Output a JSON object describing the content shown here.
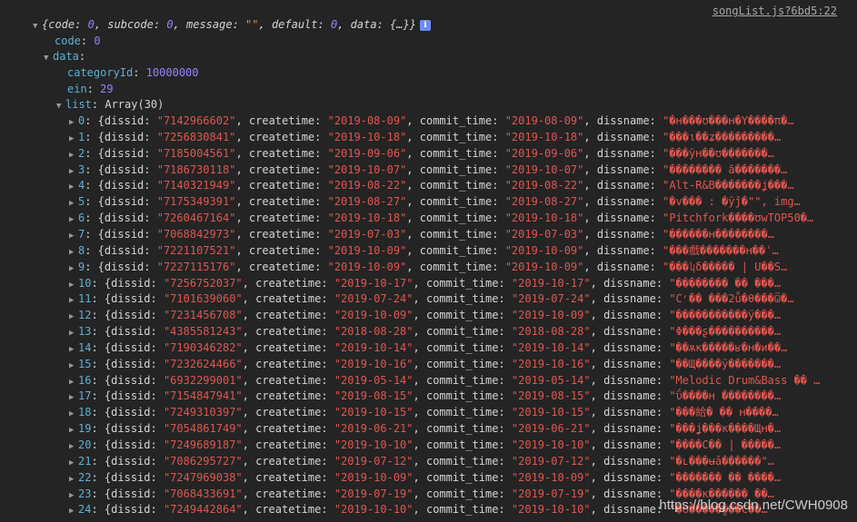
{
  "source_link": "songList.js?6bd5:22",
  "root_summary": {
    "open": "{",
    "code_key": "code",
    "code_val": "0",
    "subcode_key": "subcode",
    "subcode_val": "0",
    "message_key": "message",
    "message_val": "\"\"",
    "default_key": "default",
    "default_val": "0",
    "data_key": "data",
    "data_val": "{…}}",
    "info": "i"
  },
  "code": {
    "key": "code",
    "value": "0"
  },
  "data_label": {
    "key": "data"
  },
  "categoryId": {
    "key": "categoryId",
    "value": "10000000"
  },
  "ein": {
    "key": "ein",
    "value": "29"
  },
  "list_label": {
    "key": "list",
    "value": "Array(30)"
  },
  "labels": {
    "dissid": "dissid",
    "createtime": "createtime",
    "commit_time": "commit_time",
    "dissname": "dissname"
  },
  "rows": [
    {
      "index": "0",
      "dissid": "\"7142966602\"",
      "createtime": "\"2019-08-09\"",
      "commit_time": "\"2019-08-09\"",
      "dissname": "\"�ʜ���ʊ���ʜ�Y����π�…"
    },
    {
      "index": "1",
      "dissid": "\"7256830841\"",
      "createtime": "\"2019-10-18\"",
      "commit_time": "\"2019-10-18\"",
      "dissname": "\"���ι��ʑ���������…"
    },
    {
      "index": "2",
      "dissid": "\"7185004561\"",
      "createtime": "\"2019-09-06\"",
      "commit_time": "\"2019-09-06\"",
      "dissname": "\"���ÿʜ��ʊ�������…"
    },
    {
      "index": "3",
      "dissid": "\"7186730118\"",
      "createtime": "\"2019-10-07\"",
      "commit_time": "\"2019-10-07\"",
      "dissname": "\"��������  ã�������…"
    },
    {
      "index": "4",
      "dissid": "\"7140321949\"",
      "createtime": "\"2019-08-22\"",
      "commit_time": "\"2019-08-22\"",
      "dissname": "\"Alt-R&B�������ʝ���…"
    },
    {
      "index": "5",
      "dissid": "\"7175349391\"",
      "createtime": "\"2019-08-27\"",
      "commit_time": "\"2019-08-27\"",
      "dissname": "\"�v��� : �ÿĵ�\"\", img…"
    },
    {
      "index": "6",
      "dissid": "\"7260467164\"",
      "createtime": "\"2019-10-18\"",
      "commit_time": "\"2019-10-18\"",
      "dissname": "\"Pitchfork����ʊwTOP50�…"
    },
    {
      "index": "7",
      "dissid": "\"7068842973\"",
      "createtime": "\"2019-07-03\"",
      "commit_time": "\"2019-07-03\"",
      "dissname": "\"������ʜ��������…"
    },
    {
      "index": "8",
      "dissid": "\"7221107521\"",
      "createtime": "\"2019-10-09\"",
      "commit_time": "\"2019-10-09\"",
      "dissname": "\"���戲�������ʜ��ʿ…"
    },
    {
      "index": "9",
      "dissid": "\"7227115176\"",
      "createtime": "\"2019-10-09\"",
      "commit_time": "\"2019-10-09\"",
      "dissname": "\"���ʮδ����� | U��S…"
    },
    {
      "index": "10",
      "dissid": "\"7256752037\"",
      "createtime": "\"2019-10-17\"",
      "commit_time": "\"2019-10-17\"",
      "dissname": "\"�������� �� ���…"
    },
    {
      "index": "11",
      "dissid": "\"7101639060\"",
      "createtime": "\"2019-07-24\"",
      "commit_time": "\"2019-07-24\"",
      "dissname": "\"Cʳ��  ���2ǚ�θ���Ѿ�…"
    },
    {
      "index": "12",
      "dissid": "\"7231456708\"",
      "createtime": "\"2019-10-09\"",
      "commit_time": "\"2019-10-09\"",
      "dissname": "\"�����������ÿ���…"
    },
    {
      "index": "13",
      "dissid": "\"4385581243\"",
      "createtime": "\"2018-08-28\"",
      "commit_time": "\"2018-08-28\"",
      "dissname": "\"Φ���ʂ����������…"
    },
    {
      "index": "14",
      "dissid": "\"7190346282\"",
      "createtime": "\"2019-10-14\"",
      "commit_time": "\"2019-10-14\"",
      "dissname": "\"��ѫĸ�����ʁ�ʜ�и��…"
    },
    {
      "index": "15",
      "dissid": "\"7232624466\"",
      "createtime": "\"2019-10-16\"",
      "commit_time": "\"2019-10-16\"",
      "dissname": "\"��Щ����ÿ�������…"
    },
    {
      "index": "16",
      "dissid": "\"6932299001\"",
      "createtime": "\"2019-05-14\"",
      "commit_time": "\"2019-05-14\"",
      "dissname": "\"Melodic Drum&Bass �� …"
    },
    {
      "index": "17",
      "dissid": "\"7154847941\"",
      "createtime": "\"2019-08-15\"",
      "commit_time": "\"2019-08-15\"",
      "dissname": "\"ΰ����ʜ ��������…"
    },
    {
      "index": "18",
      "dissid": "\"7249310397\"",
      "createtime": "\"2019-10-15\"",
      "commit_time": "\"2019-10-15\"",
      "dissname": "\"���給�  �� ʜ����…"
    },
    {
      "index": "19",
      "dissid": "\"7054861749\"",
      "createtime": "\"2019-06-21\"",
      "commit_time": "\"2019-06-21\"",
      "dissname": "\"���ʝ���κ����Щʜ�…"
    },
    {
      "index": "20",
      "dissid": "\"7249689187\"",
      "createtime": "\"2019-10-10\"",
      "commit_time": "\"2019-10-10\"",
      "dissname": "\"����C�� | �����…"
    },
    {
      "index": "21",
      "dissid": "\"7086295727\"",
      "createtime": "\"2019-07-12\"",
      "commit_time": "\"2019-07-12\"",
      "dissname": "\"�ʟ���ʉǎ������\"…"
    },
    {
      "index": "22",
      "dissid": "\"7247969038\"",
      "createtime": "\"2019-10-09\"",
      "commit_time": "\"2019-10-09\"",
      "dissname": "\"�������  �� ����…"
    },
    {
      "index": "23",
      "dissid": "\"7068433691\"",
      "createtime": "\"2019-07-19\"",
      "commit_time": "\"2019-07-19\"",
      "dissname": "\"����κ������ ��…"
    },
    {
      "index": "24",
      "dissid": "\"7249442864\"",
      "createtime": "\"2019-10-10\"",
      "commit_time": "\"2019-10-10\"",
      "dissname": "\"�ʊ�����̰���Ϲ��…"
    }
  ],
  "watermark": "https://blog.csdn.net/CWH0908"
}
